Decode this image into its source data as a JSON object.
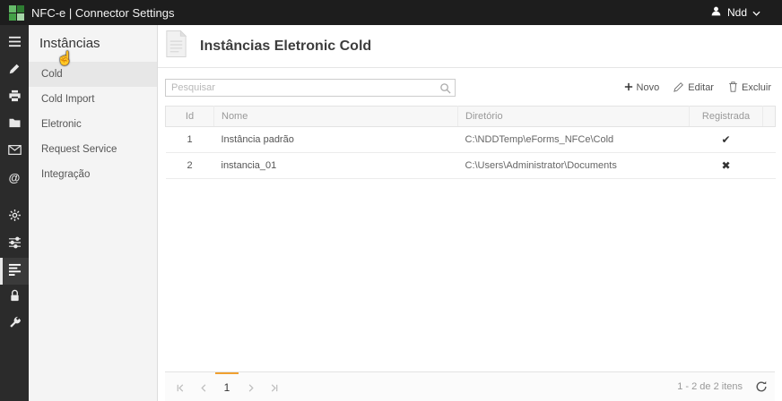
{
  "topbar": {
    "title": "NFC-e | Connector Settings",
    "user": "Ndd"
  },
  "sidebar": {
    "title": "Instâncias",
    "items": [
      {
        "label": "Cold"
      },
      {
        "label": "Cold Import"
      },
      {
        "label": "Eletronic"
      },
      {
        "label": "Request Service"
      },
      {
        "label": "Integração"
      }
    ]
  },
  "main": {
    "title": "Instâncias Eletronic Cold",
    "search": {
      "placeholder": "Pesquisar"
    },
    "actions": {
      "novo": "Novo",
      "editar": "Editar",
      "excluir": "Excluir"
    },
    "table": {
      "columns": [
        "Id",
        "Nome",
        "Diretório",
        "Registrada"
      ],
      "rows": [
        {
          "id": "1",
          "nome": "Instância padrão",
          "diretorio": "C:\\NDDTemp\\eForms_NFCe\\Cold",
          "registrada": "✔"
        },
        {
          "id": "2",
          "nome": "instancia_01",
          "diretorio": "C:\\Users\\Administrator\\Documents",
          "registrada": "✖"
        }
      ]
    },
    "pager": {
      "page": "1",
      "summary": "1 - 2 de 2 itens"
    }
  },
  "colors": {
    "topbar_bg": "#1d1d1d",
    "brand_green": "#43a047",
    "accent_orange": "#f0a030"
  }
}
